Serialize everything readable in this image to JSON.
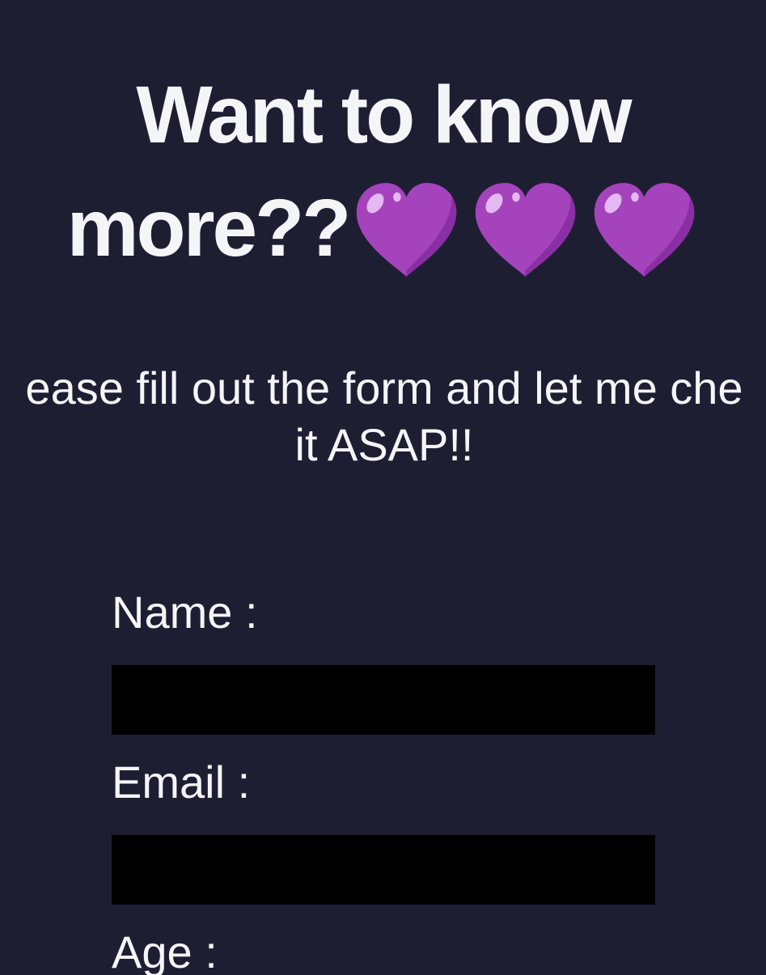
{
  "headline": {
    "line1": "Want to know",
    "line2_text": "more??",
    "emoji": [
      "purple-heart",
      "purple-heart",
      "purple-heart"
    ]
  },
  "subtitle": {
    "line1": "ease fill out the form and let me che",
    "line2": "it ASAP!!"
  },
  "form": {
    "name_label": "Name :",
    "email_label": "Email :",
    "age_label": "Age :"
  },
  "colors": {
    "background": "#1e1e33",
    "text": "#f4f5f7",
    "field": "#000000",
    "heart": "#a543bd"
  }
}
